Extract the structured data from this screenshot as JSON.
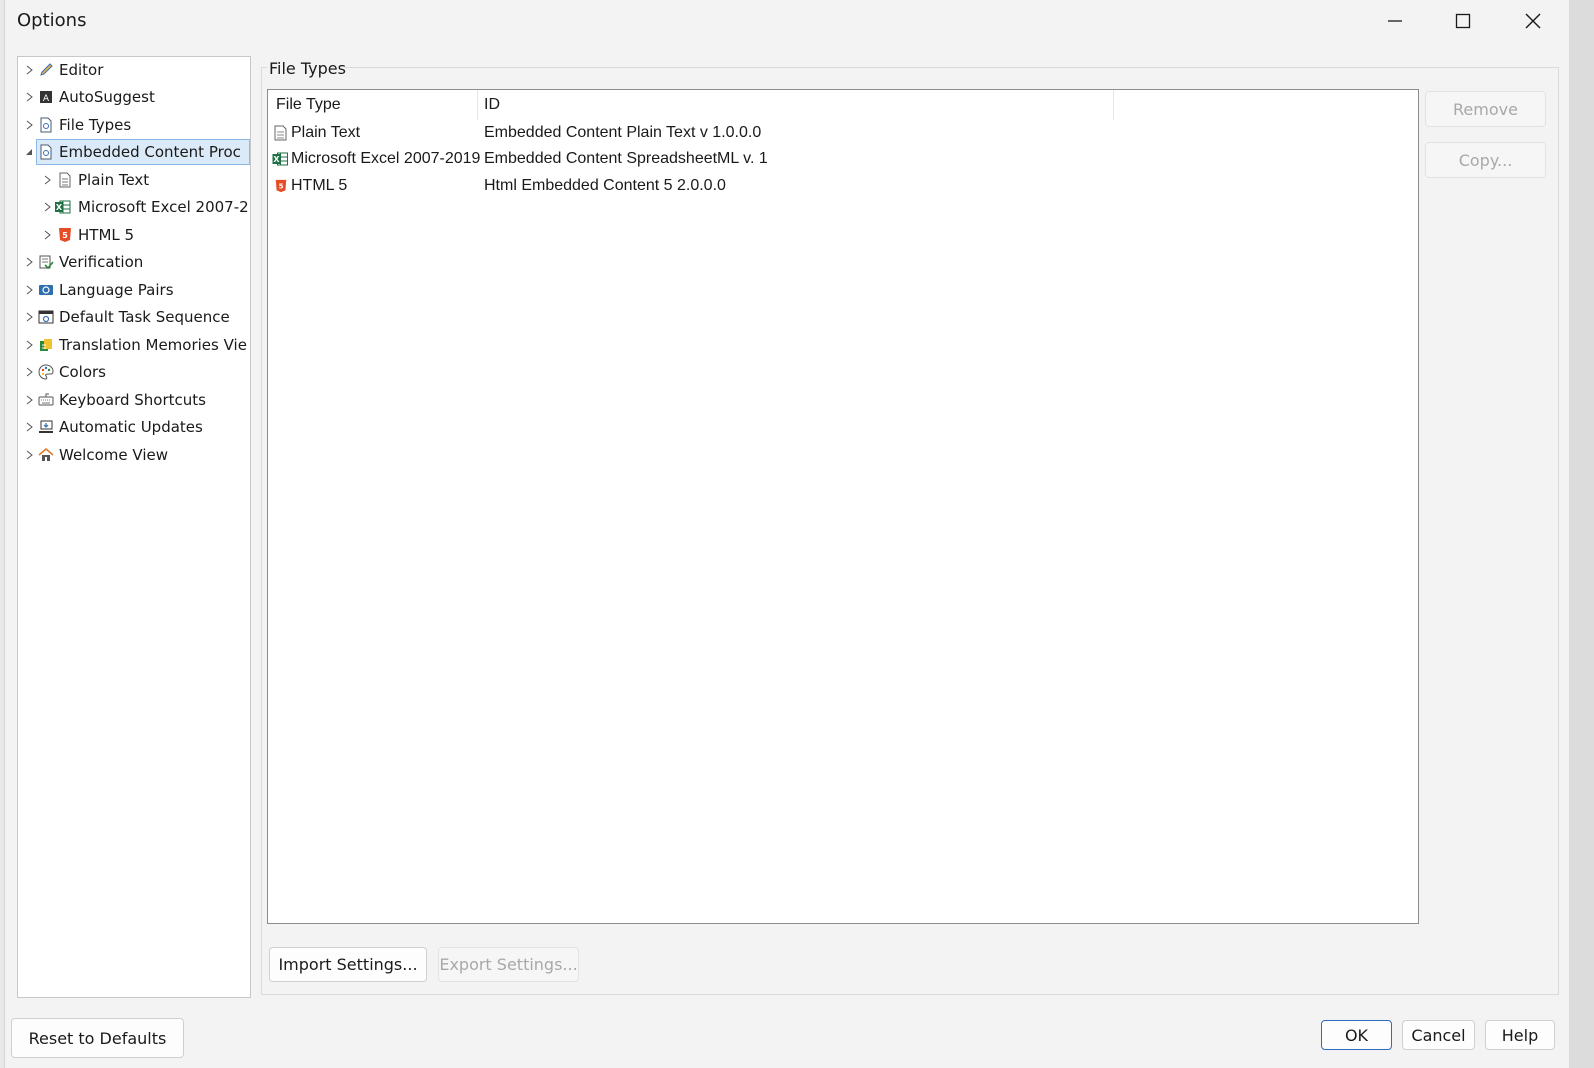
{
  "window": {
    "title": "Options"
  },
  "tree": {
    "items": [
      {
        "label": "Editor",
        "icon": "pencil-icon"
      },
      {
        "label": "AutoSuggest",
        "icon": "autosuggest-icon"
      },
      {
        "label": "File Types",
        "icon": "file-types-icon"
      },
      {
        "label": "Embedded Content Proc",
        "icon": "embedded-content-icon",
        "selected": true,
        "expanded": true
      },
      {
        "label": "Plain Text",
        "icon": "text-document-icon",
        "child": true
      },
      {
        "label": "Microsoft Excel 2007-2",
        "icon": "excel-icon",
        "child": true
      },
      {
        "label": "HTML 5",
        "icon": "html5-icon",
        "child": true
      },
      {
        "label": "Verification",
        "icon": "verification-icon"
      },
      {
        "label": "Language Pairs",
        "icon": "language-pairs-icon"
      },
      {
        "label": "Default Task Sequence",
        "icon": "task-sequence-icon"
      },
      {
        "label": "Translation Memories Vie",
        "icon": "translation-memory-icon"
      },
      {
        "label": "Colors",
        "icon": "palette-icon"
      },
      {
        "label": "Keyboard Shortcuts",
        "icon": "keyboard-icon"
      },
      {
        "label": "Automatic Updates",
        "icon": "updates-icon"
      },
      {
        "label": "Welcome View",
        "icon": "home-icon"
      }
    ]
  },
  "panel": {
    "group_label": "File Types",
    "columns": [
      "File Type",
      "ID"
    ],
    "rows": [
      {
        "file_type": "Plain Text",
        "id": "Embedded Content Plain Text v 1.0.0.0",
        "icon": "text-document-icon"
      },
      {
        "file_type": "Microsoft Excel 2007-2019",
        "id": "Embedded Content SpreadsheetML v. 1",
        "icon": "excel-icon"
      },
      {
        "file_type": "HTML 5",
        "id": "Html Embedded Content 5 2.0.0.0",
        "icon": "html5-icon"
      }
    ],
    "remove_label": "Remove",
    "copy_label": "Copy...",
    "import_label": "Import Settings...",
    "export_label": "Export Settings..."
  },
  "footer": {
    "reset_label": "Reset to Defaults",
    "ok_label": "OK",
    "cancel_label": "Cancel",
    "help_label": "Help"
  },
  "colors": {
    "selection_bg": "#dbeaf8",
    "selection_border": "#8bb8e6",
    "ok_border": "#2f6bc1",
    "excel_green": "#1e7145",
    "html5_orange": "#e44d26"
  }
}
